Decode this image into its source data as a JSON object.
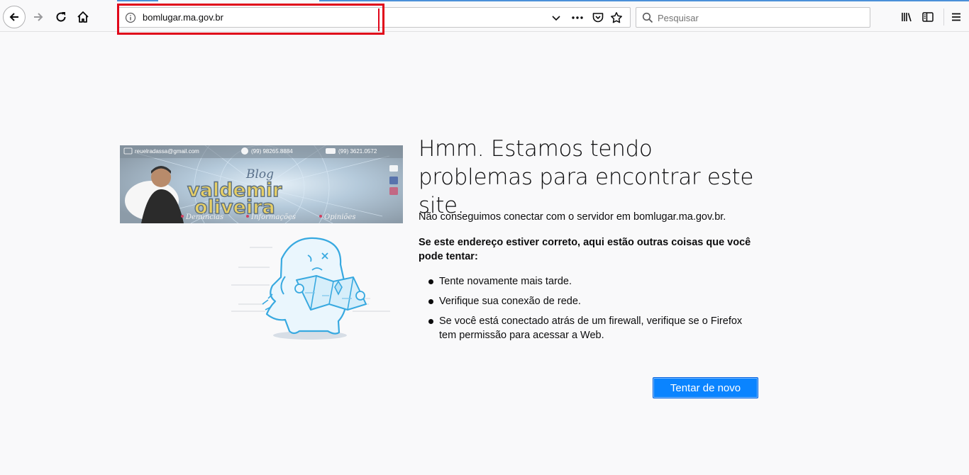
{
  "browser": {
    "url": "bomlugar.ma.gov.br",
    "search_placeholder": "Pesquisar"
  },
  "banner": {
    "email": "reuelradassa@gmail.com",
    "phone_whatsapp": "(99) 98265.8884",
    "phone": "(99) 3621.0572",
    "blog_word": "Blog",
    "name_line1": "valdemir",
    "name_line2": "oliveira",
    "tags": [
      "Denúncias",
      "Informações",
      "Opiniões"
    ]
  },
  "error": {
    "title": "Hmm. Estamos tendo problemas para encontrar este site.",
    "description": "Não conseguimos conectar com o servidor em bomlugar.ma.gov.br.",
    "tips_heading": "Se este endereço estiver correto, aqui estão outras coisas que você pode tentar:",
    "tips": [
      "Tente novamente mais tarde.",
      "Verifique sua conexão de rede.",
      "Se você está conectado atrás de um firewall, verifique se o Firefox tem permissão para acessar a Web."
    ],
    "retry_label": "Tentar de novo"
  },
  "colors": {
    "accent": "#0a84ff",
    "highlight": "#e0061a"
  }
}
